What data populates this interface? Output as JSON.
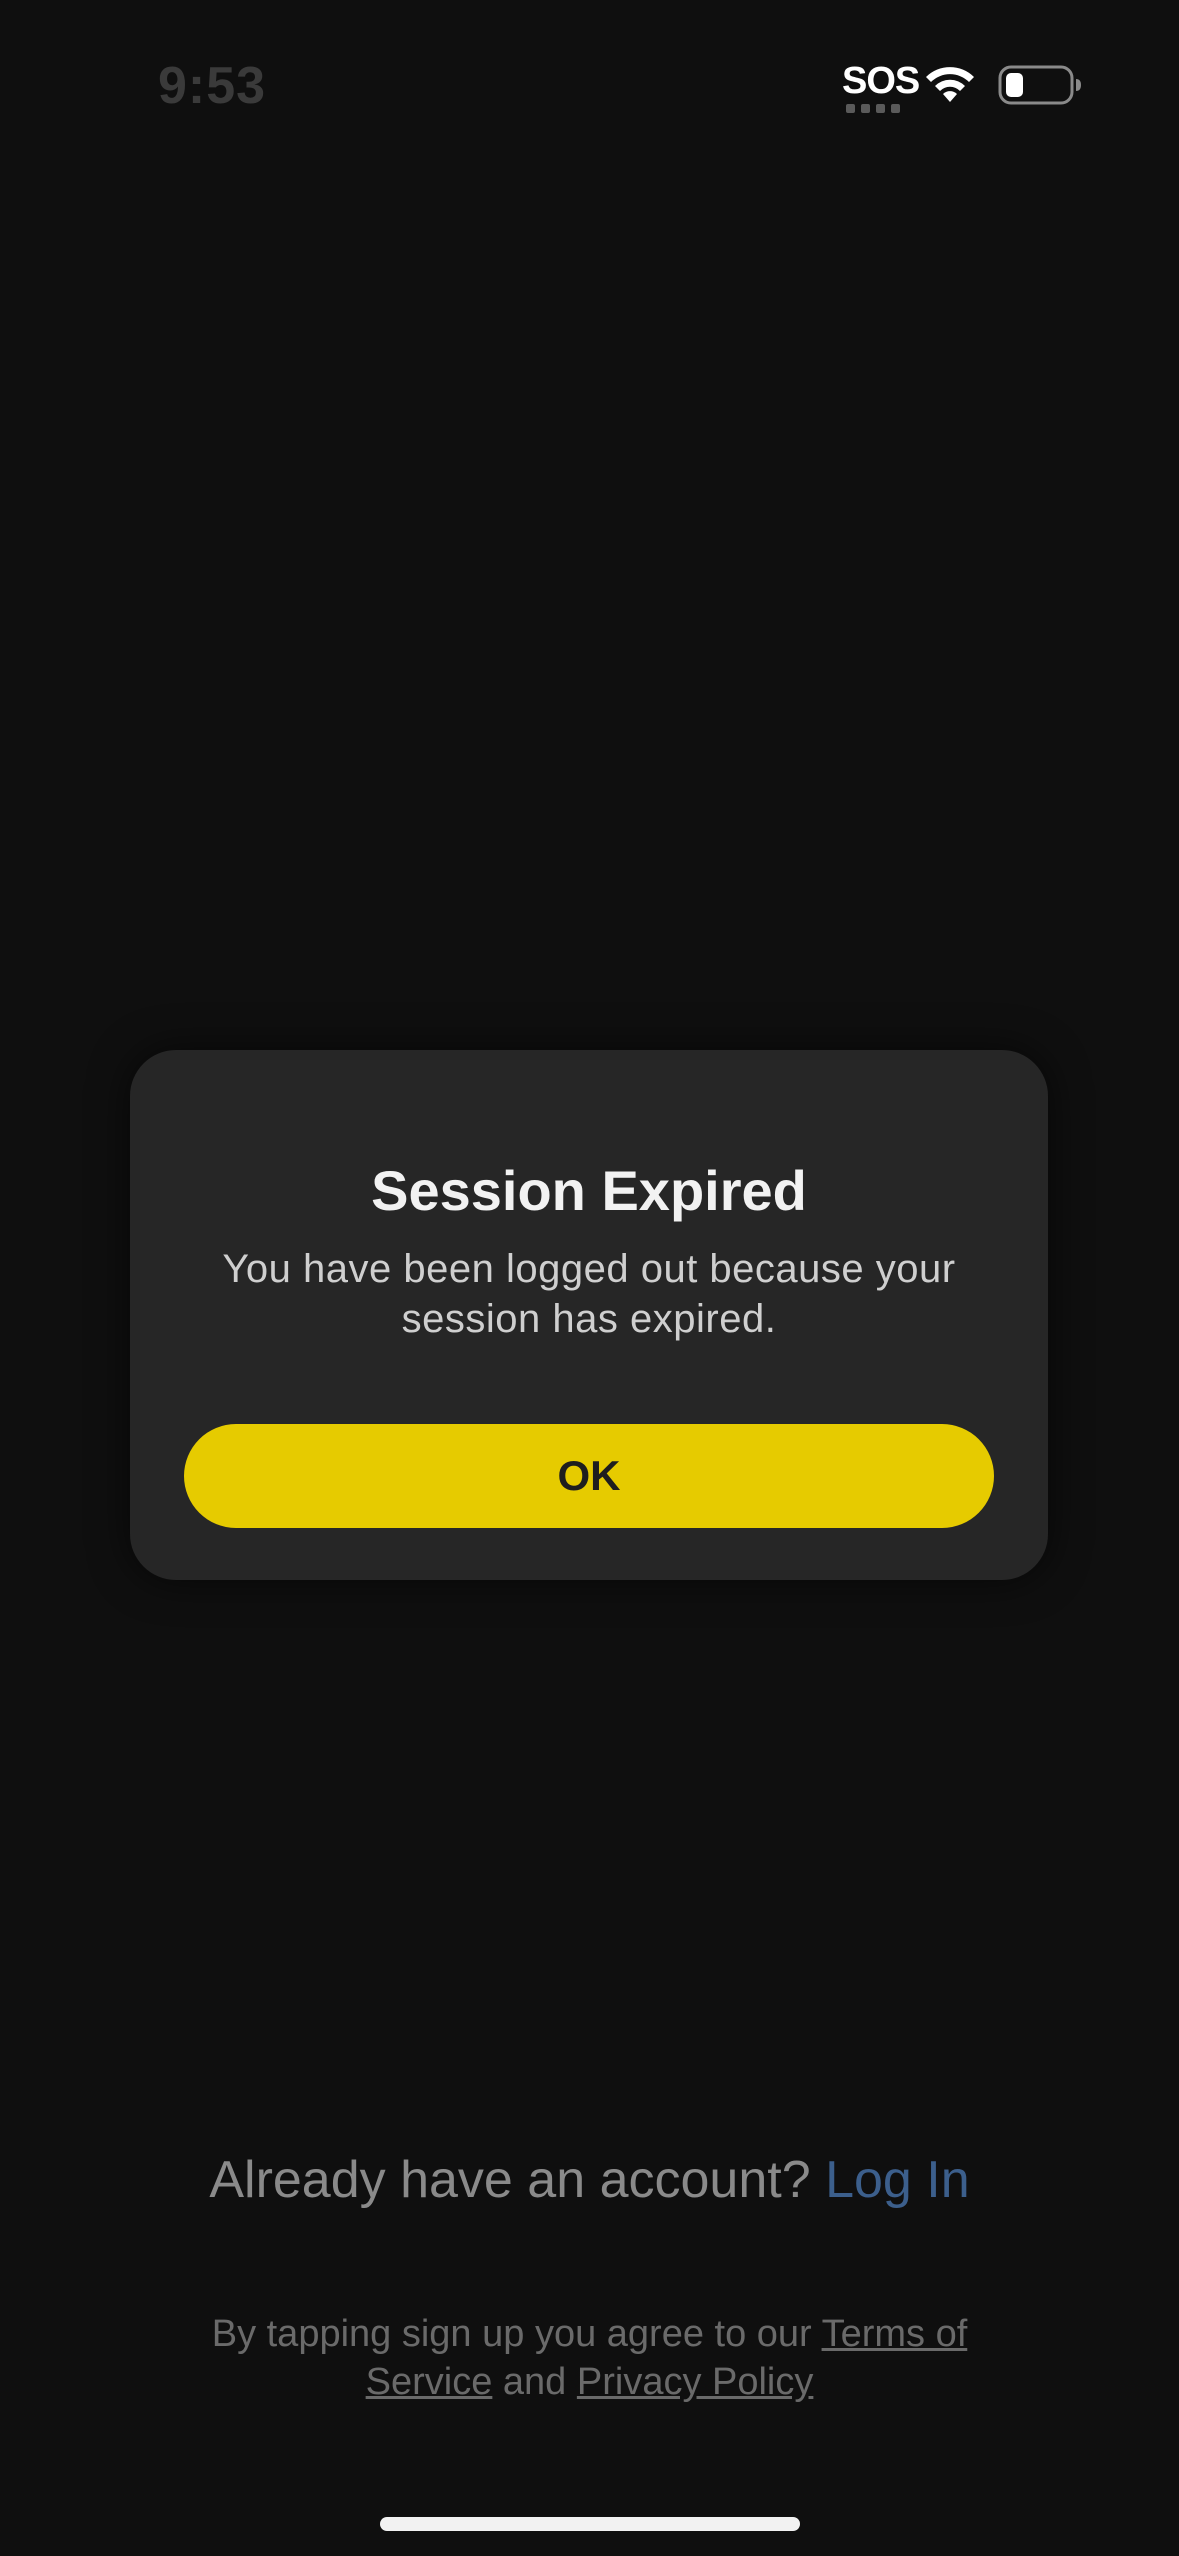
{
  "status_bar": {
    "time": "9:53",
    "carrier": "SOS",
    "icons": [
      "wifi-icon",
      "battery-icon"
    ]
  },
  "dialog": {
    "title": "Session Expired",
    "message": "You have been logged out because your session has expired.",
    "ok_label": "OK"
  },
  "footer": {
    "account_prompt": "Already have an account?",
    "login_label": "Log In",
    "legal_prefix": "By tapping sign up you agree to our",
    "terms_label": "Terms of Service",
    "legal_and": "and",
    "privacy_label": "Privacy Policy"
  },
  "colors": {
    "background": "#0f0f0f",
    "dialog_bg": "#262626",
    "accent": "#e6cb00",
    "link": "#3c5f8c"
  }
}
